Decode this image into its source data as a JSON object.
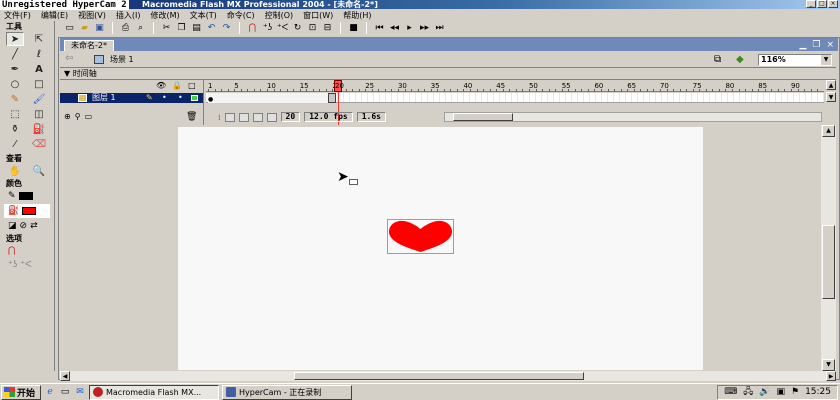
{
  "window": {
    "title": "Unregistered HyperCam 2 Macromedia Flash MX Professional 2004 - [未命名-2*]",
    "overlay": "Unregistered HyperCam 2",
    "title_visible": "Macromedia Flash MX Professional 2004 - [未命名-2*]"
  },
  "menu": [
    "文件(F)",
    "编辑(E)",
    "视图(V)",
    "插入(I)",
    "修改(M)",
    "文本(T)",
    "命令(C)",
    "控制(O)",
    "窗口(W)",
    "帮助(H)"
  ],
  "tools_panel": {
    "title": "工具",
    "view_title": "查看",
    "colors_title": "颜色",
    "options_title": "选项",
    "stroke_color": "#000000",
    "fill_color": "#ff0000"
  },
  "document": {
    "tab": "未命名-2*",
    "scene": "场景 1",
    "zoom": "116%"
  },
  "timeline": {
    "header": "时间轴",
    "layer_name": "图层 1",
    "ruler_ticks": [
      "1",
      "5",
      "10",
      "15",
      "20",
      "25",
      "30",
      "35",
      "40",
      "45",
      "50",
      "55",
      "60",
      "65",
      "70",
      "75",
      "80",
      "85",
      "90"
    ],
    "current_frame": "20",
    "frame_rate": "12.0 fps",
    "elapsed": "1.6s"
  },
  "stage": {
    "heart_color": "#ff0000"
  },
  "taskbar": {
    "start": "开始",
    "tasks": [
      "Macromedia Flash MX...",
      "HyperCam - 正在录制"
    ],
    "clock": "15:25"
  }
}
